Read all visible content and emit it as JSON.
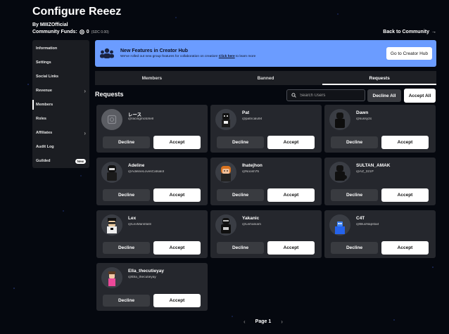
{
  "header": {
    "title": "Configure Reeez",
    "by_label": "By",
    "owner": "MIIIZOfficial",
    "funds_label": "Community Funds:",
    "funds_value": "0",
    "funds_sub": "(SDC 0.00)",
    "back_link": "Back to Community"
  },
  "sidebar": {
    "items": [
      {
        "label": "Information"
      },
      {
        "label": "Settings"
      },
      {
        "label": "Social Links"
      },
      {
        "label": "Revenue"
      },
      {
        "label": "Members"
      },
      {
        "label": "Roles"
      },
      {
        "label": "Affiliates"
      },
      {
        "label": "Audit Log"
      },
      {
        "label": "Guilded",
        "badge": "New"
      }
    ],
    "active": "Members"
  },
  "banner": {
    "title": "New Features in Creator Hub",
    "text_before": "We've rolled out new group features for collaboration on creation!",
    "link": "Click here",
    "text_after": "to learn more",
    "button": "Go to Creator Hub"
  },
  "tabs": [
    {
      "label": "Members"
    },
    {
      "label": "Banned"
    },
    {
      "label": "Requests"
    }
  ],
  "requests": {
    "heading": "Requests",
    "search_placeholder": "Search Users",
    "decline_all": "Decline All",
    "accept_all": "Accept All",
    "decline_label": "Decline",
    "accept_label": "Accept",
    "cards": [
      {
        "name": "レース",
        "username": "@racingmotohell"
      },
      {
        "name": "Pat",
        "username": "@patricalu94"
      },
      {
        "name": "Dawn",
        "username": "@sussy2o"
      },
      {
        "name": "Adeline",
        "username": "@AdelineLovesCatsalot"
      },
      {
        "name": "Ihatejhon",
        "username": "@Noosh75"
      },
      {
        "name": "SULTAN_AMAK",
        "username": "@AZ_321P"
      },
      {
        "name": "Lex",
        "username": "@LexMansfaitn"
      },
      {
        "name": "Yakanic",
        "username": "@Leihaniam"
      },
      {
        "name": "C4T",
        "username": "@BluoNapsta4"
      },
      {
        "name": "Ella_thecutieyay",
        "username": "@Ella_thecutieyay"
      }
    ]
  },
  "pagination": {
    "label": "Page 1"
  },
  "colors": {
    "background": "#05080f",
    "panel": "#25272d",
    "banner": "#6b9cff",
    "button_secondary": "#393b40",
    "button_primary": "#ffffff"
  }
}
